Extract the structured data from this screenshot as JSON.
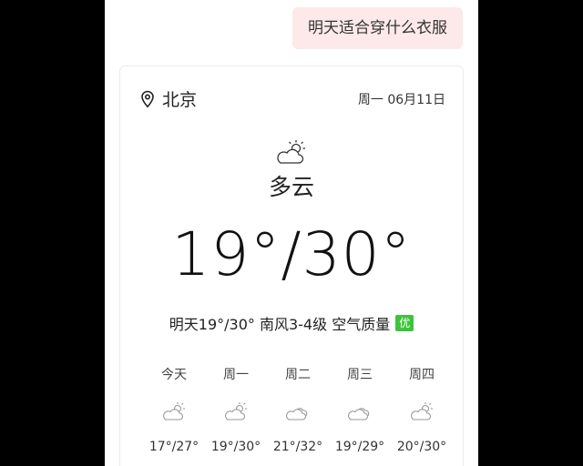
{
  "chat": {
    "user_message": "明天适合穿什么衣服"
  },
  "weather": {
    "city": "北京",
    "date": "周一 06月11日",
    "condition": "多云",
    "temp_range": "19°/30°",
    "summary_text": "明天19°/30° 南风3-4级 空气质量",
    "aqi_label": "优",
    "aqi_color": "#3cc43c",
    "forecast": [
      {
        "day": "今天",
        "icon": "partly-cloudy-icon",
        "temps": "17°/27°"
      },
      {
        "day": "周一",
        "icon": "partly-cloudy-icon",
        "temps": "19°/30°"
      },
      {
        "day": "周二",
        "icon": "cloudy-icon",
        "temps": "21°/32°"
      },
      {
        "day": "周三",
        "icon": "cloudy-icon",
        "temps": "19°/29°"
      },
      {
        "day": "周四",
        "icon": "partly-cloudy-icon",
        "temps": "20°/30°"
      }
    ]
  }
}
